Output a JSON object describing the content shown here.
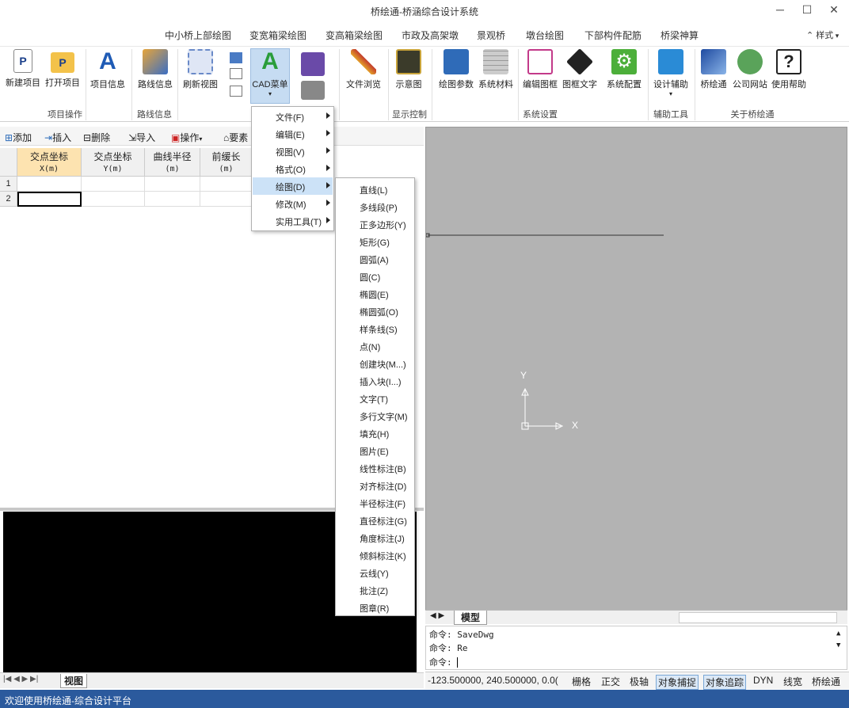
{
  "window": {
    "title": "桥绘通-桥涵综合设计系统",
    "minimize": "─",
    "maximize": "☐",
    "close": "✕"
  },
  "tabs": [
    "中小桥上部绘图",
    "变宽箱梁绘图",
    "变高箱梁绘图",
    "市政及高架墩",
    "景观桥",
    "墩台绘图",
    "下部构件配筋",
    "桥梁神算"
  ],
  "style_label": "样式",
  "ribbon": {
    "new_project": "新建项目",
    "open_project": "打开项目",
    "project_info": "项目信息",
    "route_info": "路线信息",
    "refresh_view": "刷新视图",
    "cad_menu": "CAD菜单",
    "file_browse": "文件浏览",
    "diagram": "示意图",
    "draw_params": "绘图参数",
    "sys_material": "系统材料",
    "edit_frame": "编辑图框",
    "frame_text": "图框文字",
    "sys_config": "系统配置",
    "design_aid": "设计辅助",
    "qiaohuitong": "桥绘通",
    "company_site": "公司网站",
    "help": "使用帮助"
  },
  "groups": {
    "project_ops": "项目操作",
    "route_info": "路线信息",
    "display_ctrl": "显示控制",
    "sys_settings": "系统设置",
    "aux_tools": "辅助工具",
    "about": "关于桥绘通"
  },
  "toolbar": {
    "add": "添加",
    "insert": "插入",
    "delete": "删除",
    "import": "导入",
    "operate": "操作",
    "important": "要素"
  },
  "grid": {
    "headers": [
      {
        "title": "交点坐标",
        "sub": "X(m)"
      },
      {
        "title": "交点坐标",
        "sub": "Y(m)"
      },
      {
        "title": "曲线半径",
        "sub": "(m)"
      },
      {
        "title": "前缓长",
        "sub": "(m)"
      }
    ],
    "rows": [
      "1",
      "2"
    ]
  },
  "cad_menu": {
    "items": [
      "文件(F)",
      "编辑(E)",
      "视图(V)",
      "格式(O)",
      "绘图(D)",
      "修改(M)",
      "实用工具(T)"
    ],
    "draw_sub": [
      "直线(L)",
      "多线段(P)",
      "正多边形(Y)",
      "矩形(G)",
      "圆弧(A)",
      "圆(C)",
      "椭圆(E)",
      "椭圆弧(O)",
      "样条线(S)",
      "点(N)",
      "创建块(M...)",
      "插入块(I...)",
      "文字(T)",
      "多行文字(M)",
      "填充(H)",
      "图片(E)",
      "线性标注(B)",
      "对齐标注(D)",
      "半径标注(F)",
      "直径标注(G)",
      "角度标注(J)",
      "倾斜标注(K)",
      "云线(Y)",
      "批注(Z)",
      "图章(R)"
    ]
  },
  "cad": {
    "axis_y": "Y",
    "axis_x": "X",
    "model_tab": "模型"
  },
  "command": {
    "line1": "命令:  SaveDwg",
    "line2": "命令:  Re",
    "line3": "命令:"
  },
  "status": {
    "coords": "-123.500000,  240.500000,  0.0(",
    "grid": "栅格",
    "ortho": "正交",
    "polar": "极轴",
    "osnap": "对象捕捉",
    "otrack": "对象追踪",
    "dyn": "DYN",
    "lw": "线宽",
    "app": "桥绘通"
  },
  "left_tab": "视图",
  "footer": "欢迎使用桥绘通-综合设计平台"
}
